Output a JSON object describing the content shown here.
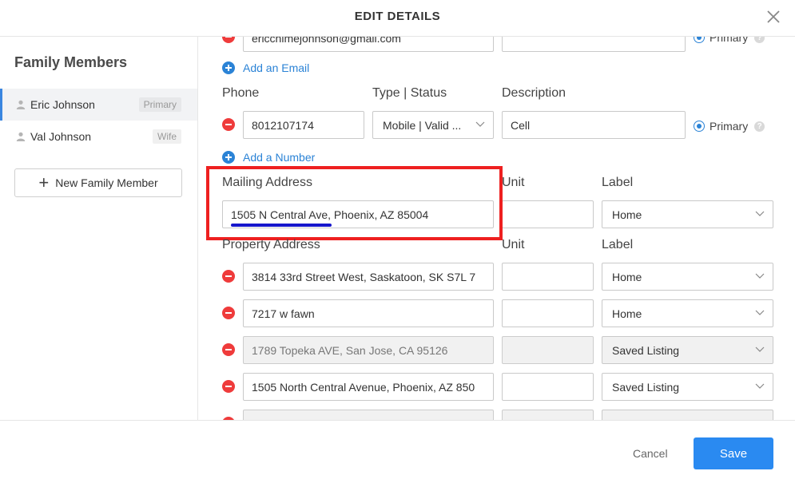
{
  "header": {
    "title": "EDIT DETAILS"
  },
  "sidebar": {
    "title": "Family Members",
    "members": [
      {
        "name": "Eric Johnson",
        "badge": "Primary"
      },
      {
        "name": "Val Johnson",
        "badge": "Wife"
      }
    ],
    "new_member_label": "New Family Member"
  },
  "email": {
    "value": "ericchimejohnson@gmail.com",
    "primary_label": "Primary",
    "add_label": "Add an Email"
  },
  "phone": {
    "headers": {
      "phone": "Phone",
      "type": "Type | Status",
      "description": "Description"
    },
    "number": "8012107174",
    "type_status": "Mobile | Valid ...",
    "description": "Cell",
    "primary_label": "Primary",
    "add_label": "Add a Number"
  },
  "mailing": {
    "headers": {
      "address": "Mailing Address",
      "unit": "Unit",
      "label": "Label"
    },
    "address": "1505 N Central Ave, Phoenix, AZ 85004",
    "unit": "",
    "label": "Home"
  },
  "property": {
    "headers": {
      "address": "Property Address",
      "unit": "Unit",
      "label": "Label"
    },
    "rows": [
      {
        "address": "3814 33rd Street West, Saskatoon, SK S7L 7",
        "unit": "",
        "label": "Home",
        "disabled": false
      },
      {
        "address": "7217 w fawn",
        "unit": "",
        "label": "Home",
        "disabled": false
      },
      {
        "address": "1789 Topeka AVE, San Jose, CA 95126",
        "unit": "",
        "label": "Saved Listing",
        "disabled": true
      },
      {
        "address": "1505 North Central Avenue, Phoenix, AZ 850",
        "unit": "",
        "label": "Saved Listing",
        "disabled": false
      }
    ]
  },
  "footer": {
    "cancel_label": "Cancel",
    "save_label": "Save"
  },
  "colors": {
    "accent": "#2a8af1",
    "remove": "#ef3b3b",
    "highlight": "#ee2020",
    "underline": "#1616cc"
  }
}
